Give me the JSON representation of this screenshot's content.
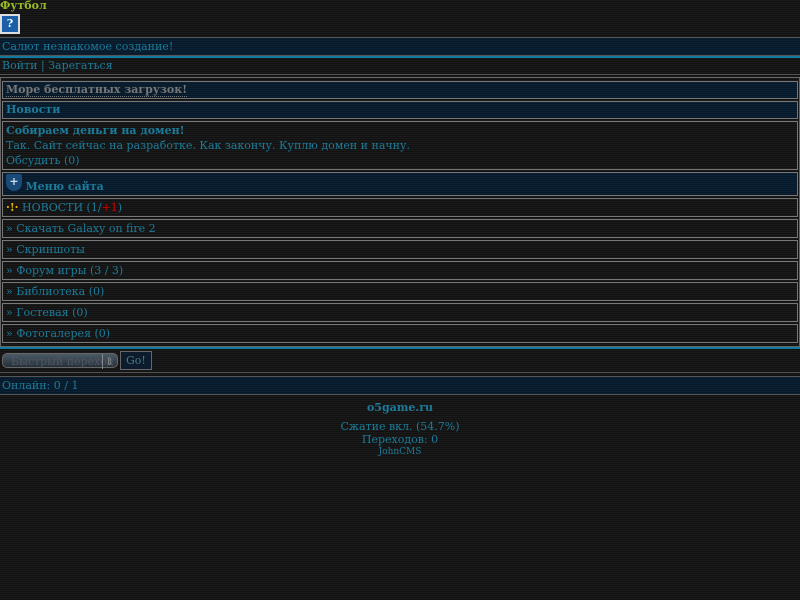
{
  "header": {
    "title": "Футбол",
    "help_label": "?"
  },
  "greeting": "Салют незнакомое создание!",
  "auth": {
    "login": "Войти",
    "separator": " | ",
    "register": "Зарегаться"
  },
  "ad": "Море бесплатных загрузок!",
  "news": {
    "heading": "Новости",
    "item_title": "Собираем деньги на домен!",
    "item_text": "Так. Сайт сейчас на разработке. Как закончу. Куплю домен и начну.",
    "discuss": "Обсудить (0)"
  },
  "menu": {
    "heading": "Меню сайта",
    "news_label": "НОВОСТИ (1/",
    "news_new": "+1",
    "news_close": ")",
    "items": [
      {
        "label": "Скачать Galaxy on fire 2"
      },
      {
        "label": "Скриншоты"
      },
      {
        "label": "Форум игры (3 / 3)"
      },
      {
        "label": "Библиотека (0)"
      },
      {
        "label": "Гостевая (0)"
      },
      {
        "label": "Фотогалерея (0)"
      }
    ]
  },
  "bullet": "»",
  "quick_jump": {
    "selected": "Быстрый переход",
    "go": "Go!"
  },
  "online": "Онлайн: 0 / 1",
  "footer": {
    "site": "o5game.ru",
    "compression": "Сжатие вкл. (54.7%)",
    "transitions": "Переходов: 0",
    "engine": "JohnCMS"
  }
}
